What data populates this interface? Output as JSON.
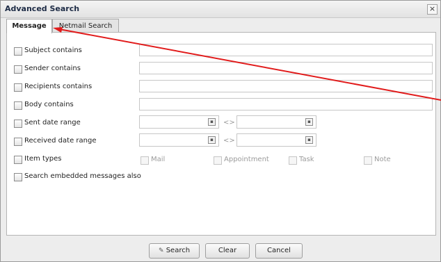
{
  "dialog": {
    "title": "Advanced Search",
    "close_glyph": "×"
  },
  "tabs": [
    {
      "label": "Message",
      "active": true
    },
    {
      "label": "Netmail Search",
      "active": false
    }
  ],
  "fields": {
    "subject": {
      "label": "Subject contains",
      "value": ""
    },
    "sender": {
      "label": "Sender contains",
      "value": ""
    },
    "recipients": {
      "label": "Recipients contains",
      "value": ""
    },
    "body": {
      "label": "Body contains",
      "value": ""
    },
    "sent_date": {
      "label": "Sent date range",
      "from": "",
      "to": "",
      "separator": "<>"
    },
    "received_date": {
      "label": "Received date range",
      "from": "",
      "to": "",
      "separator": "<>"
    },
    "item_types": {
      "label": "Item types",
      "options": [
        "Mail",
        "Appointment",
        "Task",
        "Note"
      ]
    },
    "embedded": {
      "label": "Search embedded messages also"
    }
  },
  "buttons": {
    "search": "Search",
    "clear": "Clear",
    "cancel": "Cancel"
  },
  "icons": {
    "close": "close-icon",
    "calendar": "calendar-icon",
    "search": "search-icon"
  },
  "colors": {
    "annotation_arrow": "#e11b1b",
    "dialog_bg": "#ededed",
    "panel_bg": "#ffffff"
  }
}
